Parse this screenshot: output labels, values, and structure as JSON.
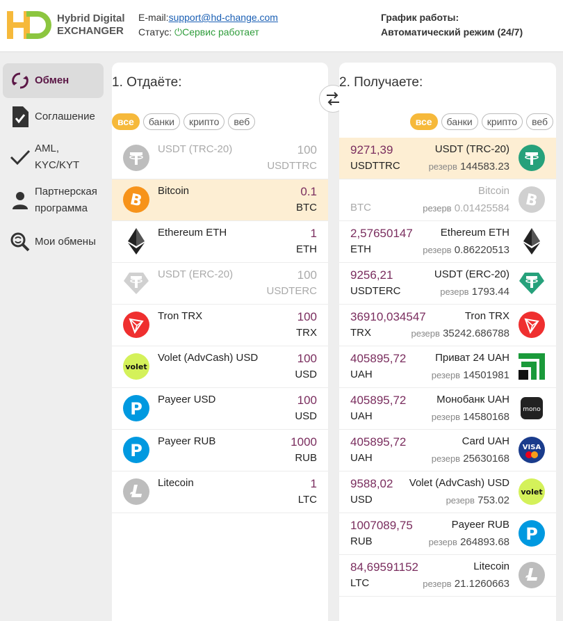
{
  "header": {
    "logo_line1": "Hybrid Digital",
    "logo_line2": "EXCHANGER",
    "email_label": "E-mail:",
    "email": "support@hd-change.com",
    "status_label": "Статус:",
    "status_value": "Сервис работает",
    "schedule_title": "График работы:",
    "schedule_value": "Автоматический режим (24/7)"
  },
  "sidebar": {
    "items": [
      {
        "label": "Обмен",
        "icon": "exchange-icon"
      },
      {
        "label": "Соглашение",
        "icon": "document-check-icon"
      },
      {
        "label": "AML,",
        "label2": "KYC/KYT",
        "icon": "checkmark-icon"
      },
      {
        "label": "Партнерская",
        "label2": "программа",
        "icon": "person-icon"
      },
      {
        "label": "Мои обмены",
        "icon": "search-history-icon"
      }
    ]
  },
  "give": {
    "title": "1. Отдаёте:",
    "filters": [
      "все",
      "банки",
      "крипто",
      "веб"
    ],
    "rows": [
      {
        "name": "USDT (TRC-20)",
        "amount": "100",
        "code": "USDTTRC",
        "icon": "tether-icon",
        "color": "#bdbdbd"
      },
      {
        "name": "Bitcoin",
        "amount": "0.1",
        "code": "BTC",
        "icon": "bitcoin-icon",
        "color": "#f7931a"
      },
      {
        "name": "Ethereum ETH",
        "amount": "1",
        "code": "ETH",
        "icon": "ethereum-icon",
        "color": "#222222"
      },
      {
        "name": "USDT (ERC-20)",
        "amount": "100",
        "code": "USDTERC",
        "icon": "tether-erc-icon",
        "color": "#d0d0d0"
      },
      {
        "name": "Tron TRX",
        "amount": "100",
        "code": "TRX",
        "icon": "tron-icon",
        "color": "#ef2f2f"
      },
      {
        "name": "Volet (AdvCash) USD",
        "amount": "100",
        "code": "USD",
        "icon": "volet-icon",
        "color": "#d4f15a"
      },
      {
        "name": "Payeer USD",
        "amount": "100",
        "code": "USD",
        "icon": "payeer-icon",
        "color": "#0099e0"
      },
      {
        "name": "Payeer RUB",
        "amount": "1000",
        "code": "RUB",
        "icon": "payeer-icon",
        "color": "#0099e0"
      },
      {
        "name": "Litecoin",
        "amount": "1",
        "code": "LTC",
        "icon": "litecoin-icon",
        "color": "#bdbdbd"
      }
    ]
  },
  "receive": {
    "title": "2. Получаете:",
    "filters": [
      "все",
      "банки",
      "крипто",
      "веб"
    ],
    "reserve_label": "резерв",
    "rows": [
      {
        "name": "USDT (TRC-20)",
        "amount": "9271,39",
        "code": "USDTTRC",
        "reserve": "144583.23",
        "icon": "tether-icon",
        "color": "#26a17b"
      },
      {
        "name": "Bitcoin",
        "amount": "",
        "code": "BTC",
        "reserve": "0.01425584",
        "icon": "bitcoin-icon",
        "color": "#d0d0d0"
      },
      {
        "name": "Ethereum ETH",
        "amount": "2,57650147",
        "code": "ETH",
        "reserve": "0.86220513",
        "icon": "ethereum-icon",
        "color": "#222222"
      },
      {
        "name": "USDT (ERC-20)",
        "amount": "9256,21",
        "code": "USDTERC",
        "reserve": "1793.44",
        "icon": "tether-erc-icon",
        "color": "#26a17b"
      },
      {
        "name": "Tron TRX",
        "amount": "36910,034547",
        "code": "TRX",
        "reserve": "35242.686788",
        "icon": "tron-icon",
        "color": "#ef2f2f"
      },
      {
        "name": "Приват 24 UAH",
        "amount": "405895,72",
        "code": "UAH",
        "reserve": "14501981",
        "icon": "privat24-icon",
        "color": "#1a9a3a"
      },
      {
        "name": "Монобанк UAH",
        "amount": "405895,72",
        "code": "UAH",
        "reserve": "14580168",
        "icon": "monobank-icon",
        "color": "#222222"
      },
      {
        "name": "Card UAH",
        "amount": "405895,72",
        "code": "UAH",
        "reserve": "25630168",
        "icon": "visa-mastercard-icon",
        "color": "#1a3c8c"
      },
      {
        "name": "Volet (AdvCash) USD",
        "amount": "9588,02",
        "code": "USD",
        "reserve": "753.02",
        "icon": "volet-icon",
        "color": "#d4f15a"
      },
      {
        "name": "Payeer RUB",
        "amount": "1007089,75",
        "code": "RUB",
        "reserve": "264893.68",
        "icon": "payeer-icon",
        "color": "#0099e0"
      },
      {
        "name": "Litecoin",
        "amount": "84,69591152",
        "code": "LTC",
        "reserve": "21.1260663",
        "icon": "litecoin-icon",
        "color": "#bdbdbd"
      }
    ]
  },
  "colors": {
    "accent": "#f6b93b",
    "brand": "#5b1746",
    "amount": "#7a2d5e",
    "selected_row": "#fdeed3"
  }
}
